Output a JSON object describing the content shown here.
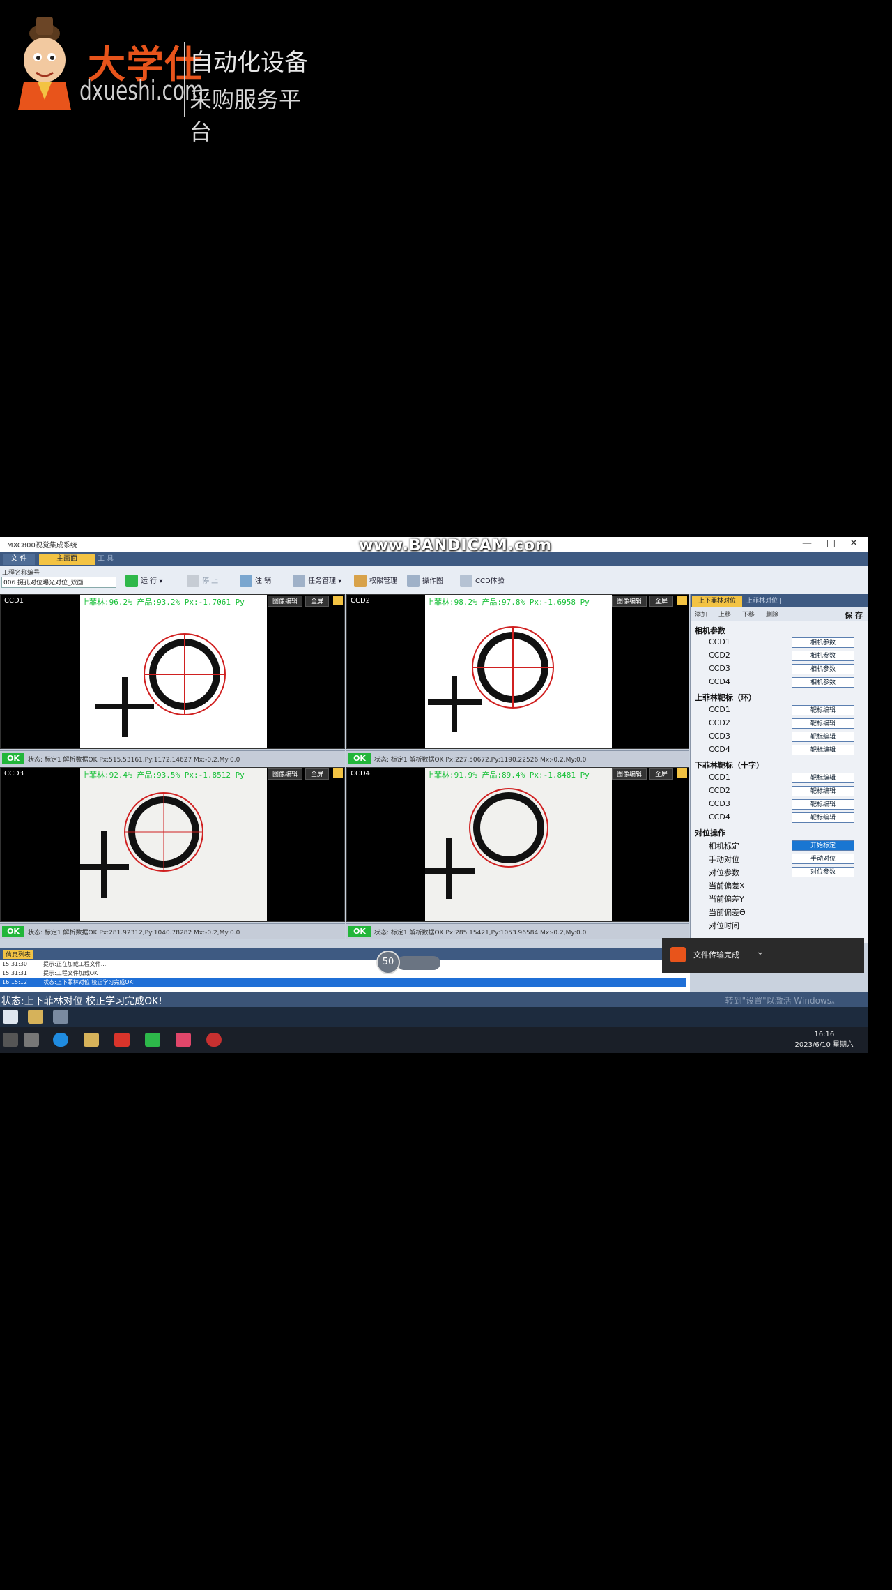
{
  "logo": {
    "brand_cn": "大学仕",
    "brand_en": "dxueshi.com",
    "tagline1": "自动化设备",
    "tagline2": "采购服务平台"
  },
  "window": {
    "title": "MXC800视觉集成系统",
    "controls": [
      "—",
      "□",
      "✕"
    ],
    "watermark": "www.BANDICAM.com"
  },
  "menu": {
    "file": "文 件",
    "tab_main": "主画面",
    "tab_tools": "工 具"
  },
  "toolbar": {
    "project_label": "工程名称编号",
    "project_value": "006 摄孔对位曝光对位_双面",
    "run": "运 行",
    "stop": "停 止",
    "login": "注 销",
    "task_mgr": "任务管理",
    "perm_mgr": "权限管理",
    "sequence": "操作图",
    "ccd_test": "CCD体验"
  },
  "cameras": [
    {
      "label": "CCD1",
      "stat": "上菲林:96.2%  产品:93.2%  Px:-1.7061  Py",
      "status": "状态: 标定1  解析数据OK   Px:515.53161,Py:1172.14627  Mx:-0.2,My:0.0"
    },
    {
      "label": "CCD2",
      "stat": "上菲林:98.2%  产品:97.8%  Px:-1.6958  Py",
      "status": "状态: 标定1  解析数据OK   Px:227.50672,Py:1190.22526  Mx:-0.2,My:0.0"
    },
    {
      "label": "CCD3",
      "stat": "上菲林:92.4%  产品:93.5%  Px:-1.8512  Py",
      "status": "状态: 标定1  解析数据OK   Px:281.92312,Py:1040.78282  Mx:-0.2,My:0.0"
    },
    {
      "label": "CCD4",
      "stat": "上菲林:91.9%  产品:89.4%  Px:-1.8481  Py",
      "status": "状态: 标定1  解析数据OK   Px:285.15421,Py:1053.96584  Mx:-0.2,My:0.0"
    }
  ],
  "camera_buttons": {
    "edit": "图像编辑",
    "full": "全屏"
  },
  "ok_label": "OK",
  "right_panel": {
    "tab1": "上下菲林对位",
    "tab2": "上菲林对位 |",
    "sub": [
      "添加",
      "上移",
      "下移",
      "删除"
    ],
    "save": "保 存",
    "sections": [
      {
        "title": "相机参数",
        "items": [
          {
            "label": "CCD1",
            "btn": "相机参数"
          },
          {
            "label": "CCD2",
            "btn": "相机参数"
          },
          {
            "label": "CCD3",
            "btn": "相机参数"
          },
          {
            "label": "CCD4",
            "btn": "相机参数"
          }
        ]
      },
      {
        "title": "上菲林靶标（环）",
        "items": [
          {
            "label": "CCD1",
            "btn": "靶标编辑"
          },
          {
            "label": "CCD2",
            "btn": "靶标编辑"
          },
          {
            "label": "CCD3",
            "btn": "靶标编辑"
          },
          {
            "label": "CCD4",
            "btn": "靶标编辑"
          }
        ]
      },
      {
        "title": "下菲林靶标（十字）",
        "items": [
          {
            "label": "CCD1",
            "btn": "靶标编辑"
          },
          {
            "label": "CCD2",
            "btn": "靶标编辑"
          },
          {
            "label": "CCD3",
            "btn": "靶标编辑"
          },
          {
            "label": "CCD4",
            "btn": "靶标编辑"
          }
        ]
      },
      {
        "title": "对位操作",
        "items": [
          {
            "label": "相机标定",
            "btn": "开始标定"
          },
          {
            "label": "手动对位",
            "btn": "手动对位"
          },
          {
            "label": "对位参数",
            "btn": "对位参数"
          },
          {
            "label": "当前偏差X",
            "btn": ""
          },
          {
            "label": "当前偏差Y",
            "btn": ""
          },
          {
            "label": "当前偏差Θ",
            "btn": ""
          },
          {
            "label": "对位时间",
            "btn": ""
          }
        ]
      }
    ]
  },
  "messages": {
    "header": "信息列表",
    "rows": [
      {
        "time": "15:31:30",
        "text": "提示:正在加载工程文件..."
      },
      {
        "time": "15:31:31",
        "text": "提示:工程文件加载OK"
      },
      {
        "time": "16:15:12",
        "text": "状态:上下菲林对位 校正学习完成OK!"
      }
    ]
  },
  "notification": {
    "text": "文件传输完成"
  },
  "speed": {
    "value": "50"
  },
  "statusbar": {
    "text": "状态:上下菲林对位 校正学习完成OK!",
    "watermark": "转到\"设置\"以激活 Windows。"
  },
  "clock": {
    "time": "16:16",
    "date": "2023/6/10 星期六"
  },
  "colors": {
    "accent": "#f3c343",
    "ok": "#22b63a",
    "status": "#18c038",
    "brand": "#e8541b",
    "nav": "#3e5a82"
  }
}
